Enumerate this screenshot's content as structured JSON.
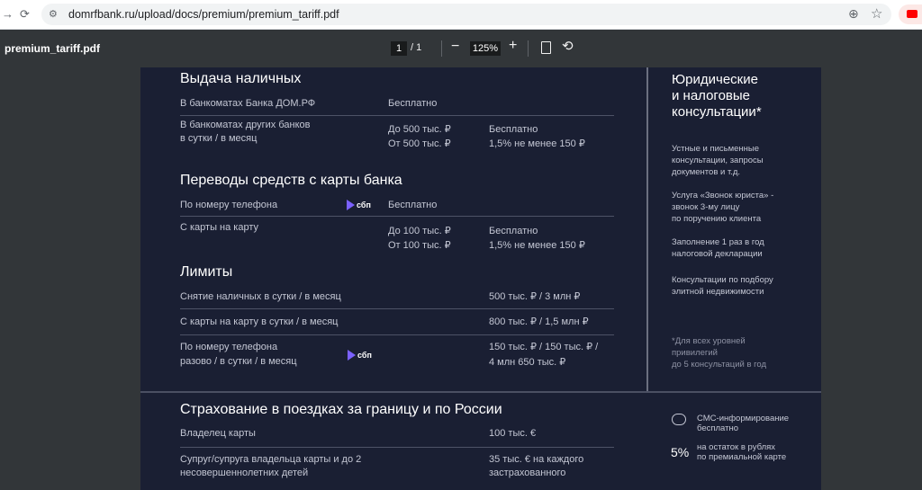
{
  "browser": {
    "url": "domrfbank.ru/upload/docs/premium/premium_tariff.pdf"
  },
  "pdf_toolbar": {
    "filename": "premium_tariff.pdf",
    "page_current": "1",
    "page_total": "/ 1",
    "zoom": "125%"
  },
  "cash": {
    "heading": "Выдача наличных",
    "row1": {
      "label": "В банкоматах Банка ДОМ.РФ",
      "value": "Бесплатно"
    },
    "row2": {
      "label_l1": "В банкоматах других банков",
      "label_l2": "в сутки / в месяц",
      "cond_l1": "До 500 тыс. ₽",
      "cond_l2": "От 500 тыс. ₽",
      "fee_l1": "Бесплатно",
      "fee_l2": "1,5% не менее 150 ₽"
    }
  },
  "transfers": {
    "heading": "Переводы средств с карты банка",
    "row1": {
      "label": "По номеру телефона",
      "sbp": "сбп",
      "value": "Бесплатно"
    },
    "row2": {
      "label": "С карты на карту",
      "cond_l1": "До 100 тыс. ₽",
      "cond_l2": "От 100 тыс. ₽",
      "fee_l1": "Бесплатно",
      "fee_l2": "1,5% не менее 150 ₽"
    }
  },
  "limits": {
    "heading": "Лимиты",
    "row1": {
      "label": "Снятие наличных в сутки / в месяц",
      "value": "500 тыс. ₽ /  3 млн ₽"
    },
    "row2": {
      "label": "С карты на карту в сутки / в месяц",
      "value": "800 тыс. ₽ /  1,5 млн ₽"
    },
    "row3": {
      "label_l1": "По номеру телефона",
      "label_l2": "разово / в сутки / в месяц",
      "sbp": "сбп",
      "value_l1": "150 тыс. ₽ / 150 тыс. ₽ /",
      "value_l2": "4 млн 650 тыс. ₽"
    }
  },
  "legal": {
    "heading_l1": "Юридические",
    "heading_l2": "и налоговые",
    "heading_l3": "консультации*",
    "item1_l1": "Устные и письменные",
    "item1_l2": "консультации, запросы",
    "item1_l3": "документов и т.д.",
    "item2_l1": "Услуга «Звонок юриста» -",
    "item2_l2": "звонок 3-му лицу",
    "item2_l3": "по поручению клиента",
    "item3_l1": "Заполнение 1 раз в год",
    "item3_l2": "налоговой декларации",
    "item4_l1": "Консультации по подбору",
    "item4_l2": "элитной недвижимости",
    "note_l1": "*Для всех уровней",
    "note_l2": "привилегий",
    "note_l3": "до 5 консультаций в год"
  },
  "insurance": {
    "heading": "Страхование в поездках за границу и по России",
    "row1": {
      "label": "Владелец карты",
      "value": "100 тыс. €"
    },
    "row2": {
      "label_l1": "Супруг/супруга владельца карты и до 2",
      "label_l2": "несовершеннолетних детей",
      "value_l1": "35 тыс. €  на каждого",
      "value_l2": "застрахованного"
    }
  },
  "extras": {
    "sms_l1": "СМС-информирование",
    "sms_l2": "бесплатно",
    "percent": "5%",
    "cashback_l1": "на остаток в рублях",
    "cashback_l2": "по премиальной карте"
  }
}
